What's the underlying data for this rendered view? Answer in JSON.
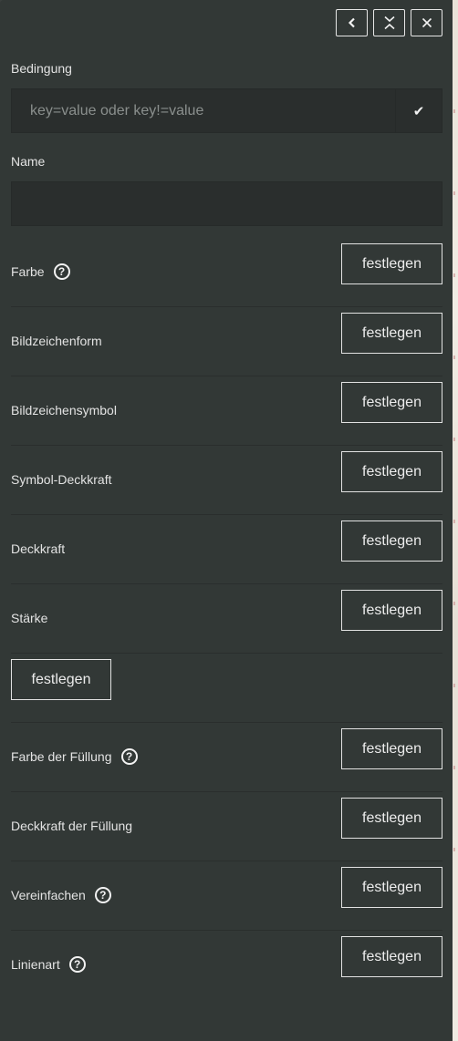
{
  "header": {
    "buttons": [
      {
        "name": "back",
        "icon": "chevron-left-icon"
      },
      {
        "name": "collapse",
        "icon": "collapse-icon"
      },
      {
        "name": "close",
        "icon": "close-icon"
      }
    ]
  },
  "condition": {
    "label": "Bedingung",
    "placeholder": "key=value oder key!=value",
    "value": "",
    "confirm_icon": "✔"
  },
  "name_field": {
    "label": "Name",
    "value": ""
  },
  "set_label": "festlegen",
  "rows": [
    {
      "label": "Farbe",
      "help": "?"
    },
    {
      "label": "Bildzeichenform"
    },
    {
      "label": "Bildzeichensymbol"
    },
    {
      "label": "Symbol-Deckkraft"
    },
    {
      "label": "Deckkraft"
    },
    {
      "label": "Stärke"
    },
    {
      "label": ""
    },
    {
      "label": "Farbe der Füllung",
      "help": "?"
    },
    {
      "label": "Deckkraft der Füllung"
    },
    {
      "label": "Vereinfachen",
      "help": "?"
    },
    {
      "label": "Linienart",
      "help": "?"
    }
  ]
}
